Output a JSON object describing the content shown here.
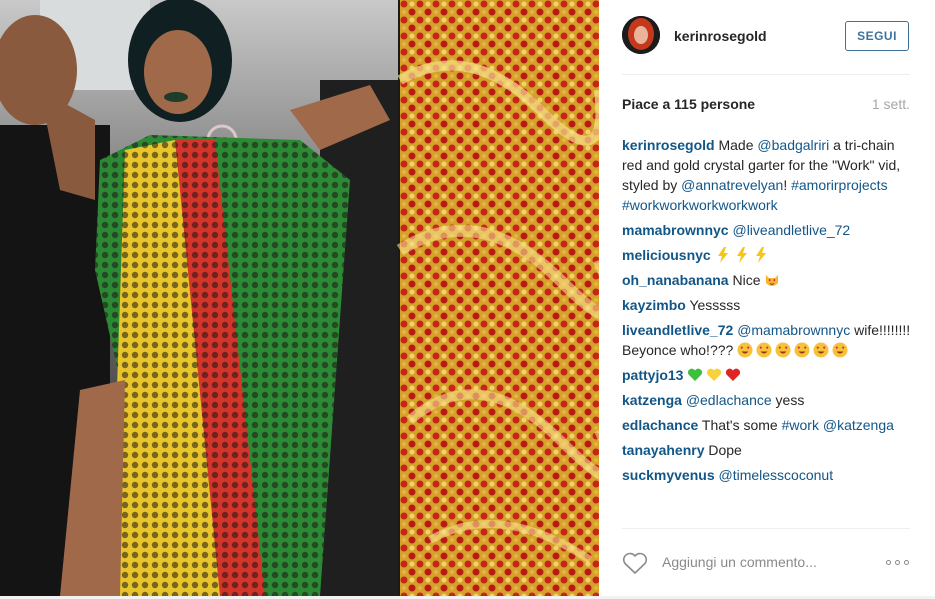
{
  "header": {
    "username": "kerinrosegold",
    "follow_label": "SEGUI"
  },
  "meta": {
    "likes_text": "Piace a 115 persone",
    "time_text": "1 sett."
  },
  "caption": {
    "user": "kerinrosegold",
    "parts": [
      "Made ",
      "@badgalriri",
      " a tri-chain red and gold crystal garter for the \"Work\" vid, styled by ",
      "@annatrevelyan",
      "! ",
      "#amorirprojects",
      " ",
      "#workworkworkworkwork"
    ]
  },
  "comments": [
    {
      "user": "mamabrownnyc",
      "link": "@liveandletlive_72",
      "text": ""
    },
    {
      "user": "meliciousnyc",
      "text": ""
    },
    {
      "user": "oh_nanabanana",
      "text": "Nice"
    },
    {
      "user": "kayzimbo",
      "text": "Yesssss"
    },
    {
      "user": "liveandletlive_72",
      "link": "@mamabrownnyc",
      "text": "wife!!!!!!!! Beyonce who!???"
    },
    {
      "user": "pattyjo13",
      "text": ""
    },
    {
      "user": "katzenga",
      "link": "@edlachance",
      "text": "yess"
    },
    {
      "user": "edlachance",
      "text": "That's some",
      "link": "#work",
      "link2": "@katzenga"
    },
    {
      "user": "tanayahenry",
      "text": "Dope"
    },
    {
      "user": "suckmyvenus",
      "link": "@timelesscoconut",
      "text": ""
    }
  ],
  "comment_box": {
    "placeholder": "Aggiungi un commento..."
  },
  "icons": {
    "heart": "heart-outline-icon",
    "more": "more-options-icon",
    "lightning": "high-voltage-emoji",
    "heart_eyes": "smiling-face-heart-eyes-emoji",
    "cat": "heart-eyes-cat-emoji"
  },
  "colors": {
    "link": "#125688",
    "follow": "#3f729b",
    "muted": "#a5a7aa"
  }
}
